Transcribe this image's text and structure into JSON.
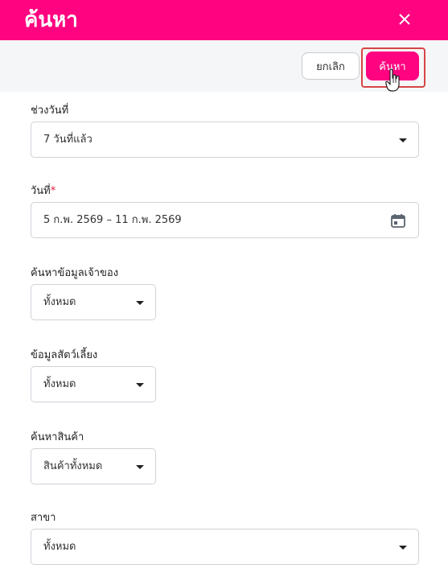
{
  "header": {
    "title": "ค้นหา",
    "close_icon": "close-icon",
    "color": "#ff0380"
  },
  "toolbar": {
    "cancel_label": "ยกเลิก",
    "search_label": "ค้นหา"
  },
  "form": {
    "date_range": {
      "label": "ช่วงวันที่",
      "value": "7 วันที่แล้ว"
    },
    "date": {
      "label": "วันที่",
      "required_mark": "*",
      "value": "5 ก.พ. 2569 – 11 ก.พ. 2569",
      "icon": "calendar-icon"
    },
    "owner": {
      "label": "ค้นหาข้อมูลเจ้าของ",
      "value": "ทั้งหมด"
    },
    "pet": {
      "label": "ข้อมูลสัตว์เลี้ยง",
      "value": "ทั้งหมด"
    },
    "product": {
      "label": "ค้นหาสินค้า",
      "value": "สินค้าทั้งหมด"
    },
    "branch": {
      "label": "สาขา",
      "value": "ทั้งหมด"
    }
  }
}
